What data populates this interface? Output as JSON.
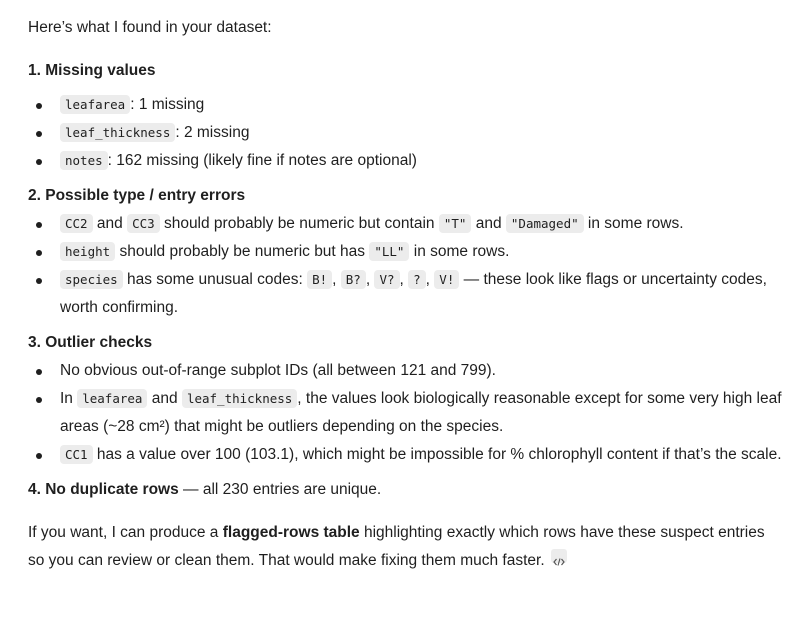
{
  "intro": "Here’s what I found in your dataset:",
  "s1": {
    "title": "1. Missing values",
    "i1": {
      "code": "leafarea",
      "text": ": 1 missing"
    },
    "i2": {
      "code": "leaf_thickness",
      "text": ": 2 missing"
    },
    "i3": {
      "code": "notes",
      "text": ": 162 missing (likely fine if notes are optional)"
    }
  },
  "s2": {
    "title": "2. Possible type / entry errors",
    "i1": {
      "c1": "CC2",
      "t1": " and ",
      "c2": "CC3",
      "t2": " should probably be numeric but contain ",
      "c3": "\"T\"",
      "t3": " and ",
      "c4": "\"Damaged\"",
      "t4": " in some rows."
    },
    "i2": {
      "c1": "height",
      "t1": " should probably be numeric but has ",
      "c2": "\"LL\"",
      "t2": " in some rows."
    },
    "i3": {
      "c1": "species",
      "t1": " has some unusual codes: ",
      "c2": "B!",
      "s1": ", ",
      "c3": "B?",
      "s2": ", ",
      "c4": "V?",
      "s3": ", ",
      "c5": "?",
      "s4": ", ",
      "c6": "V!",
      "t2": " — these look like flags or uncertainty codes, worth confirming."
    }
  },
  "s3": {
    "title": "3. Outlier checks",
    "i1": {
      "text": "No obvious out-of-range subplot IDs (all between 121 and 799)."
    },
    "i2": {
      "t0": "In ",
      "c1": "leafarea",
      "t1": " and ",
      "c2": "leaf_thickness",
      "t2": ", the values look biologically reasonable except for some very high leaf areas (~28 cm²) that might be outliers depending on the species."
    },
    "i3": {
      "c1": "CC1",
      "t1": " has a value over 100 (103.1), which might be impossible for % chlorophyll content if that’s the scale."
    }
  },
  "s4": {
    "bold": "4. No duplicate rows",
    "text": " — all 230 entries are unique."
  },
  "outro": {
    "t1": "If you want, I can produce a ",
    "bold": "flagged-rows table",
    "t2": " highlighting exactly which rows have these suspect entries so you can review or clean them. That would make fixing them much faster.",
    "icon": "code-icon"
  }
}
